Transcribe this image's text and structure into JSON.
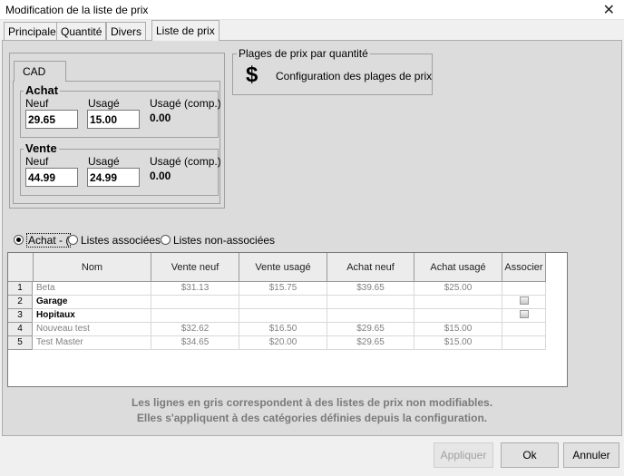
{
  "window": {
    "title": "Modification de la liste de prix",
    "close_glyph": "✕"
  },
  "tabs": [
    "Principale",
    "Quantité",
    "Divers",
    "Liste de prix"
  ],
  "currency_tab": "CAD",
  "achat": {
    "title": "Achat",
    "neuf_label": "Neuf",
    "usage_label": "Usagé",
    "comp_label": "Usagé (comp.)",
    "neuf": "29.65",
    "usage": "15.00",
    "comp": "0.00"
  },
  "vente": {
    "title": "Vente",
    "neuf_label": "Neuf",
    "usage_label": "Usagé",
    "comp_label": "Usagé (comp.)",
    "neuf": "44.99",
    "usage": "24.99",
    "comp": "0.00"
  },
  "plages": {
    "title": "Plages de prix par quantité",
    "icon": "dollar-icon",
    "icon_glyph": "$",
    "button": "Configuration des plages de prix"
  },
  "radios": [
    {
      "label": "Achat - (",
      "checked": true
    },
    {
      "label": "Listes associées",
      "checked": false
    },
    {
      "label": "Listes non-associées",
      "checked": false
    }
  ],
  "grid": {
    "columns": [
      "Nom",
      "Vente neuf",
      "Vente usagé",
      "Achat neuf",
      "Achat usagé",
      "Associer"
    ],
    "rows": [
      {
        "num": "1",
        "nom": "Beta",
        "vente_neuf": "$31.13",
        "vente_usage": "$15.75",
        "achat_neuf": "$39.65",
        "achat_usage": "$25.00",
        "bold": false,
        "check": false
      },
      {
        "num": "2",
        "nom": "Garage",
        "vente_neuf": "",
        "vente_usage": "",
        "achat_neuf": "",
        "achat_usage": "",
        "bold": true,
        "check": true
      },
      {
        "num": "3",
        "nom": "Hopitaux",
        "vente_neuf": "",
        "vente_usage": "",
        "achat_neuf": "",
        "achat_usage": "",
        "bold": true,
        "check": true
      },
      {
        "num": "4",
        "nom": "Nouveau test",
        "vente_neuf": "$32.62",
        "vente_usage": "$16.50",
        "achat_neuf": "$29.65",
        "achat_usage": "$15.00",
        "bold": false,
        "check": false
      },
      {
        "num": "5",
        "nom": "Test Master",
        "vente_neuf": "$34.65",
        "vente_usage": "$20.00",
        "achat_neuf": "$29.65",
        "achat_usage": "$15.00",
        "bold": false,
        "check": false
      }
    ]
  },
  "note": {
    "line1": "Les lignes en gris correspondent à des listes de prix non modifiables.",
    "line2": "Elles s'appliquent à des catégories définies depuis la configuration."
  },
  "buttons": {
    "apply": "Appliquer",
    "ok": "Ok",
    "cancel": "Annuler"
  }
}
